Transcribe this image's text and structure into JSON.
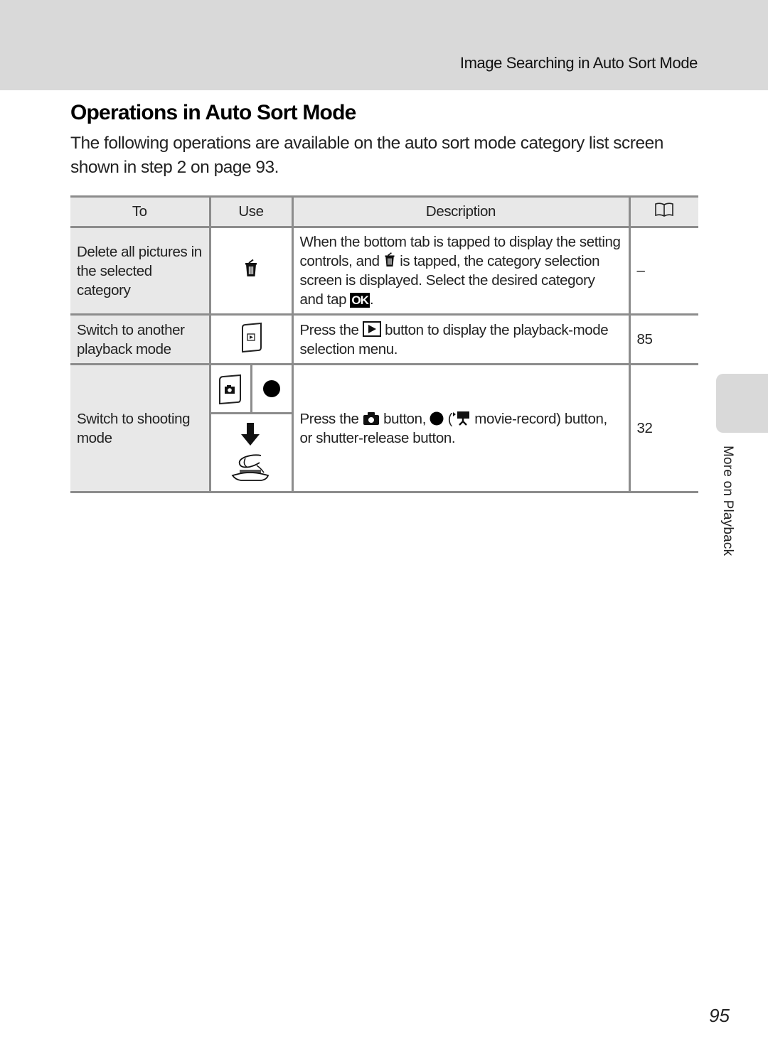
{
  "header": {
    "running_head": "Image Searching in Auto Sort Mode"
  },
  "main": {
    "title": "Operations in Auto Sort Mode",
    "intro": "The following operations are available on the auto sort mode category list screen shown in step 2 on page 93."
  },
  "table": {
    "columns": {
      "to": "To",
      "use": "Use",
      "description": "Description",
      "reference": "book-icon"
    },
    "rows": [
      {
        "to": "Delete all pictures in the selected category",
        "use_icons": [
          "trash-icon"
        ],
        "description": {
          "part1": "When the bottom tab is tapped to display the setting controls, and ",
          "icon1": "trash-icon",
          "part2": " is tapped, the category selection screen is displayed. Select the desired category and tap ",
          "badge": "OK",
          "part3": "."
        },
        "reference": "–"
      },
      {
        "to": "Switch to another playback mode",
        "use_icons": [
          "playback-button-icon"
        ],
        "description": {
          "part1": "Press the ",
          "icon1": "play-icon",
          "part2": " button to display the playback-mode selection menu."
        },
        "reference": "85"
      },
      {
        "to": "Switch to shooting mode",
        "use_icons": [
          "shooting-button-icon",
          "movie-record-dot-icon",
          "shutter-release-press-icon"
        ],
        "description": {
          "part1": "Press the ",
          "icon1": "camera-icon",
          "part2": " button, ",
          "icon2": "record-dot-icon",
          "part3": " (",
          "icon3": "movie-camera-icon",
          "part4": " movie-record) button, or shutter-release button."
        },
        "reference": "32"
      }
    ]
  },
  "sidebar": {
    "section_label": "More on Playback"
  },
  "footer": {
    "page_number": "95"
  }
}
